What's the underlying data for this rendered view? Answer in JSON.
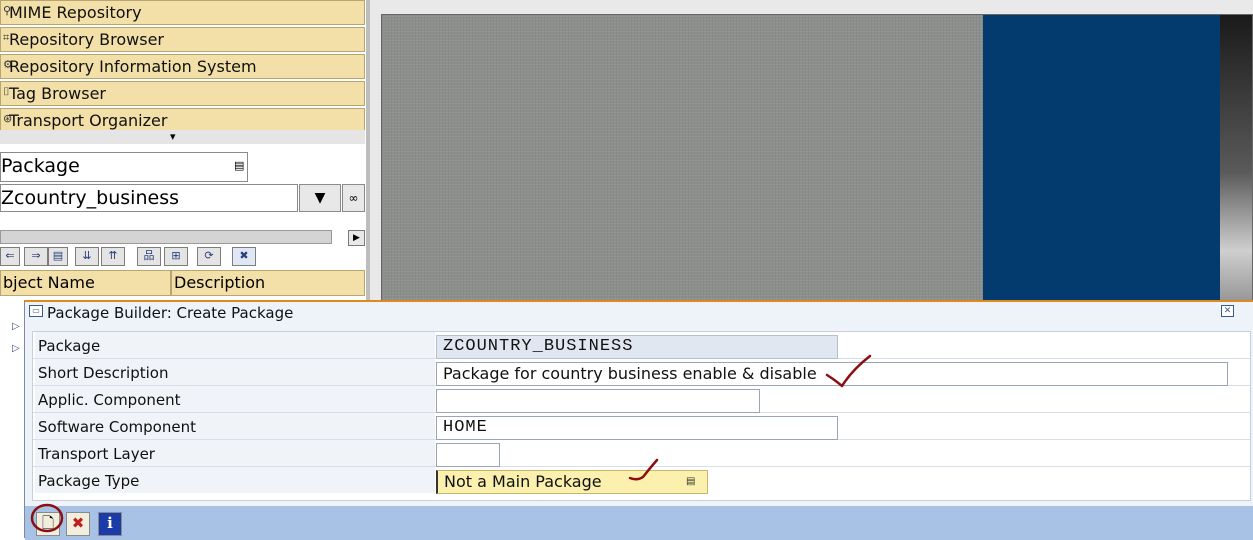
{
  "nav": {
    "items": [
      {
        "label": "MIME Repository",
        "icon": "mime-icon"
      },
      {
        "label": "Repository Browser",
        "icon": "repository-browser-icon"
      },
      {
        "label": "Repository Information System",
        "icon": "info-system-icon"
      },
      {
        "label": "Tag Browser",
        "icon": "tag-icon"
      },
      {
        "label": "Transport Organizer",
        "icon": "transport-icon"
      }
    ],
    "expand_arrow": "▾"
  },
  "object_selector": {
    "type_value": "Package",
    "name_value": "Zcountry_business"
  },
  "object_table": {
    "columns": [
      "bject Name",
      "Description"
    ]
  },
  "dialog": {
    "title": "Package Builder: Create Package",
    "fields": [
      {
        "label": "Package",
        "value": "ZCOUNTRY_BUSINESS"
      },
      {
        "label": "Short Description",
        "value": "Package for country business enable & disable"
      },
      {
        "label": "Applic. Component",
        "value": ""
      },
      {
        "label": "Software Component",
        "value": "HOME"
      },
      {
        "label": "Transport Layer",
        "value": ""
      },
      {
        "label": "Package Type",
        "value": "Not a Main Package"
      }
    ],
    "buttons": {
      "create_icon": "🗋",
      "cancel_icon": "✖",
      "info_icon": "i"
    }
  },
  "colors": {
    "nav_bg": "#f3dfa8",
    "dialog_bg": "#eef3fa",
    "dialog_accent": "#e08a1e",
    "footer_bg": "#a7c2e4",
    "annotation": "#8a0f12"
  }
}
